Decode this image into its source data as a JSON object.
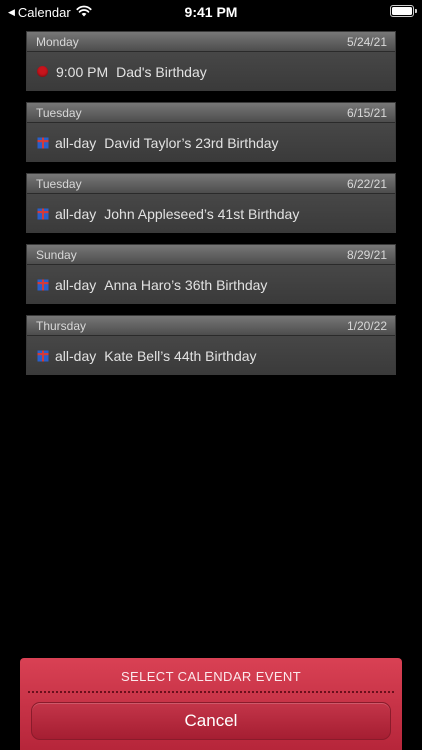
{
  "status_bar": {
    "back_app": "Calendar",
    "time": "9:41 PM"
  },
  "events": [
    {
      "day": "Monday",
      "date": "5/24/21",
      "icon": "red-dot-icon",
      "time": "9:00 PM",
      "title": "Dad's Birthday"
    },
    {
      "day": "Tuesday",
      "date": "6/15/21",
      "icon": "birthday-gift-icon",
      "time": "all-day",
      "title": "David Taylor’s 23rd Birthday"
    },
    {
      "day": "Tuesday",
      "date": "6/22/21",
      "icon": "birthday-gift-icon",
      "time": "all-day",
      "title": "John Appleseed’s 41st Birthday"
    },
    {
      "day": "Sunday",
      "date": "8/29/21",
      "icon": "birthday-gift-icon",
      "time": "all-day",
      "title": "Anna Haro’s 36th Birthday"
    },
    {
      "day": "Thursday",
      "date": "1/20/22",
      "icon": "birthday-gift-icon",
      "time": "all-day",
      "title": "Kate Bell’s 44th Birthday"
    }
  ],
  "action_sheet": {
    "title": "SELECT CALENDAR EVENT",
    "cancel_label": "Cancel"
  },
  "colors": {
    "accent_red": "#c8141c",
    "sheet_red": "#c5344a",
    "background": "#000000"
  }
}
